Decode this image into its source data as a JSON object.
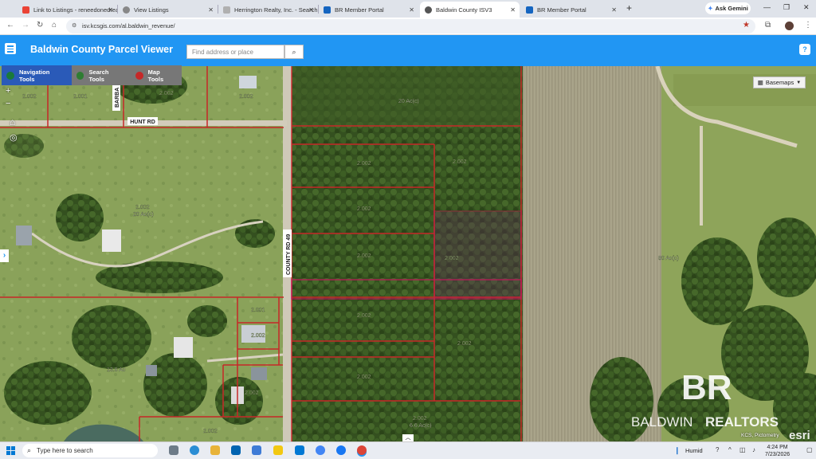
{
  "browser": {
    "tabs": [
      {
        "title": "Link to Listings - reneedonedream",
        "active": false
      },
      {
        "title": "View Listings",
        "active": false
      },
      {
        "title": "Herrington Realty, Inc. - Search",
        "active": false
      },
      {
        "title": "BR Member Portal",
        "active": false
      },
      {
        "title": "Baldwin County ISV3",
        "active": true
      },
      {
        "title": "BR Member Portal",
        "active": false
      }
    ],
    "gemini_label": "Ask Gemini",
    "url": "isv.kcsgis.com/al.baldwin_revenue/"
  },
  "app": {
    "title": "Baldwin County Parcel Viewer",
    "search_placeholder": "Find address or place",
    "help": "?"
  },
  "toolbar": {
    "nav": "Navigation Tools",
    "search": "Search Tools",
    "map": "Map Tools"
  },
  "map": {
    "basemaps_label": "Basemaps",
    "roads": {
      "hunt": "HUNT RD",
      "county": "COUNTY RD 49",
      "barb": "BARBA"
    },
    "acreage": [
      "20 Ac(c)",
      "20 Ac(c)",
      "80 Ac(c)",
      "13.6 Ac",
      "6.6 Ac(c)"
    ],
    "parcel_code": "2.002",
    "parcel_labels": [
      "2.002",
      "2.001",
      "2.002",
      "2.002",
      "2.002",
      "2.002",
      "2.002",
      "2.002",
      "2.002",
      "2.002",
      "2.002",
      "2.002",
      "2.002",
      "2.001",
      "2.002",
      "2.002",
      "2.002",
      "2.002",
      "2.002",
      "2.002",
      "2.002",
      "2.002",
      "2.002",
      "2.002"
    ],
    "brand": "BALDWIN",
    "brand2": "REALTORS",
    "brand_mark": "BR",
    "esri": "esri",
    "credit": "KCS, Pictometry"
  },
  "taskbar": {
    "search_placeholder": "Type here to search",
    "weather": "Humid",
    "time": "4:24 PM",
    "date": "7/23/2026"
  },
  "colors": {
    "appbar": "#2196f3",
    "parcel_line": "#c62828",
    "selected_parcel": "#c2185b"
  }
}
